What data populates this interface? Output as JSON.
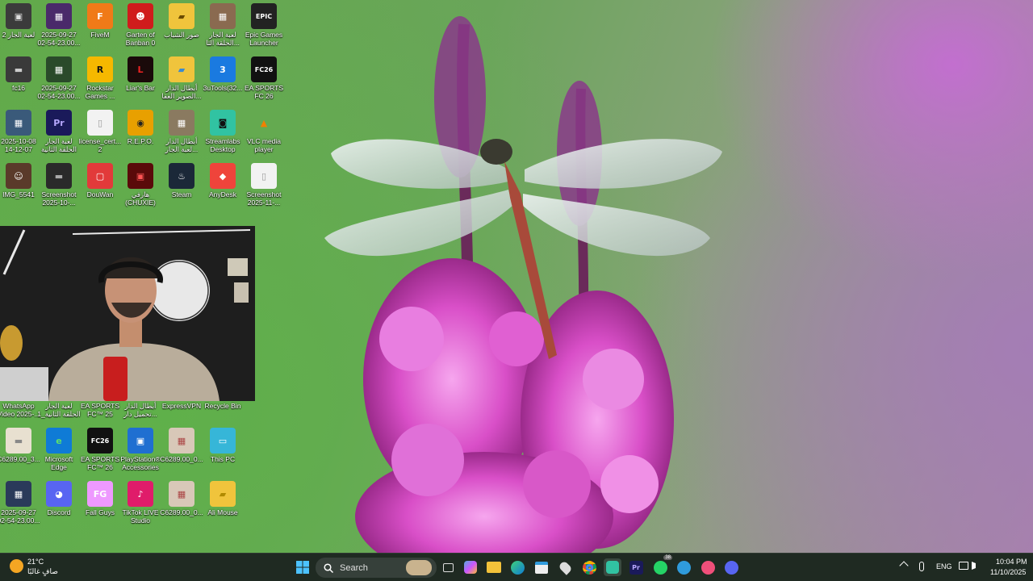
{
  "desktop": {
    "icons": [
      {
        "label": "لعبة الجار 2",
        "glyph": "▣",
        "bg": "#3b3b3b",
        "fg": "#ddd"
      },
      {
        "label": "2025-09-27\n02-54-23.00...",
        "glyph": "▦",
        "bg": "#4a2a6a",
        "fg": "#fff"
      },
      {
        "label": "FiveM",
        "glyph": "F",
        "bg": "#f07a18",
        "fg": "#fff"
      },
      {
        "label": "Garten of\nBanban 0",
        "glyph": "☻",
        "bg": "#d01c1c",
        "fg": "#fff"
      },
      {
        "label": "صور الشباب",
        "glyph": "▰",
        "bg": "#f0c43c",
        "fg": "#6a4a00"
      },
      {
        "label": "لعبة الجار\nالحلقة الثا...",
        "glyph": "▦",
        "bg": "#8a6a50",
        "fg": "#fff"
      },
      {
        "label": "Epic Games\nLauncher",
        "glyph": "EPIC",
        "bg": "#222",
        "fg": "#fff"
      },
      {
        "label": "fc16",
        "glyph": "▬",
        "bg": "#3a3a3a",
        "fg": "#ccc"
      },
      {
        "label": "2025-09-27\n02-54-23.00...",
        "glyph": "▦",
        "bg": "#2a4a2a",
        "fg": "#fff"
      },
      {
        "label": "Rockstar\nGames ...",
        "glyph": "R",
        "bg": "#f5b800",
        "fg": "#111"
      },
      {
        "label": "Liar's Bar",
        "glyph": "L",
        "bg": "#1a0a0a",
        "fg": "#e22"
      },
      {
        "label": "أبطال الدار\nالصوير العفا...",
        "glyph": "▰",
        "bg": "#f0c43c",
        "fg": "#3a8ad0"
      },
      {
        "label": "3uTools(32...",
        "glyph": "3",
        "bg": "#1a7ae0",
        "fg": "#fff"
      },
      {
        "label": "EA SPORTS\nFC 26",
        "glyph": "FC26",
        "bg": "#111",
        "fg": "#fff"
      },
      {
        "label": "2025-10-08\n14-12-07",
        "glyph": "▦",
        "bg": "#3a5a7a",
        "fg": "#fff"
      },
      {
        "label": "لعبة الجار\nالحلقة الثانية",
        "glyph": "Pr",
        "bg": "#1a1a5a",
        "fg": "#b8a8ff"
      },
      {
        "label": "license_cert...\n2",
        "glyph": "▯",
        "bg": "#f2f2f2",
        "fg": "#999"
      },
      {
        "label": "R.E.P.O.",
        "glyph": "◉",
        "bg": "#e8a000",
        "fg": "#222"
      },
      {
        "label": "أبطال الدار\nلعبة الجار...",
        "glyph": "▦",
        "bg": "#8a7a60",
        "fg": "#fff"
      },
      {
        "label": "Streamlabs\nDesktop",
        "glyph": "◙",
        "bg": "#31c3a2",
        "fg": "#111"
      },
      {
        "label": "VLC media\nplayer",
        "glyph": "▲",
        "bg": "rgba(0,0,0,0)",
        "fg": "#f08000"
      },
      {
        "label": "IMG_5541",
        "glyph": "☺",
        "bg": "#5a3a2a",
        "fg": "#fff"
      },
      {
        "label": "Screenshot\n2025-10-...",
        "glyph": "▬",
        "bg": "#2a2a2a",
        "fg": "#aaa"
      },
      {
        "label": "DouWan",
        "glyph": "▢",
        "bg": "#e23a3a",
        "fg": "#fff"
      },
      {
        "label": "هارفي\n(CHUXIE)",
        "glyph": "▣",
        "bg": "#5a0a0a",
        "fg": "#f55"
      },
      {
        "label": "Steam",
        "glyph": "♨",
        "bg": "#1b2838",
        "fg": "#fff"
      },
      {
        "label": "AnyDesk",
        "glyph": "◆",
        "bg": "#ef443b",
        "fg": "#fff"
      },
      {
        "label": "Screenshot\n2025-11-...",
        "glyph": "▯",
        "bg": "#f2f2f2",
        "fg": "#999"
      },
      {
        "label": "WhatsApp\nVideo 2025-...",
        "glyph": "",
        "bg": "rgba(0,0,0,0)",
        "fg": "#fff"
      },
      {
        "label": "لعبة الجار\nالحلقة الثانية_1",
        "glyph": "",
        "bg": "rgba(0,0,0,0)",
        "fg": "#fff"
      },
      {
        "label": "EA SPORTS\nFC™ 25",
        "glyph": "",
        "bg": "rgba(0,0,0,0)",
        "fg": "#fff"
      },
      {
        "label": "أبطال الدار\nتحميل دار...",
        "glyph": "",
        "bg": "rgba(0,0,0,0)",
        "fg": "#fff"
      },
      {
        "label": "ExpressVPN",
        "glyph": "",
        "bg": "rgba(0,0,0,0)",
        "fg": "#fff"
      },
      {
        "label": "Recycle Bin",
        "glyph": "",
        "bg": "rgba(0,0,0,0)",
        "fg": "#fff"
      },
      {
        "label": "C6289.00_3...",
        "glyph": "▬",
        "bg": "#e8e0d0",
        "fg": "#888"
      },
      {
        "label": "Microsoft\nEdge",
        "glyph": "e",
        "bg": "#0f7bd6",
        "fg": "#5ee06a"
      },
      {
        "label": "EA SPORTS\nFC™ 26",
        "glyph": "FC26",
        "bg": "#111",
        "fg": "#fff"
      },
      {
        "label": "PlayStation®\nAccessories",
        "glyph": "▣",
        "bg": "#1f6fd1",
        "fg": "#fff"
      },
      {
        "label": "C6289.00_0...",
        "glyph": "▦",
        "bg": "#d8c8b8",
        "fg": "#a44"
      },
      {
        "label": "This PC",
        "glyph": "▭",
        "bg": "#36b6d8",
        "fg": "#fff"
      },
      {
        "label": "2025-09-27\n02-54-23.00...",
        "glyph": "▦",
        "bg": "#2a3a5a",
        "fg": "#fff"
      },
      {
        "label": "Discord",
        "glyph": "◕",
        "bg": "#5865f2",
        "fg": "#fff"
      },
      {
        "label": "Fall Guys",
        "glyph": "FG",
        "bg": "#e9f",
        "fg": "#fff"
      },
      {
        "label": "TikTok LIVE\nStudio",
        "glyph": "♪",
        "bg": "#e01c6a",
        "fg": "#fff"
      },
      {
        "label": "C6289.00_0...",
        "glyph": "▦",
        "bg": "#d8c8b8",
        "fg": "#a44"
      },
      {
        "label": "Ali Mouse",
        "glyph": "▰",
        "bg": "#f0c43c",
        "fg": "#b08a00"
      }
    ]
  },
  "taskbar": {
    "weather_temp": "21°C",
    "weather_desc": "صافٍ غالبًا",
    "search_label": "Search",
    "language": "ENG",
    "time": "10:04 PM",
    "date": "11/10/2025",
    "badge_count": "38",
    "accent": "#2f9bdc"
  }
}
